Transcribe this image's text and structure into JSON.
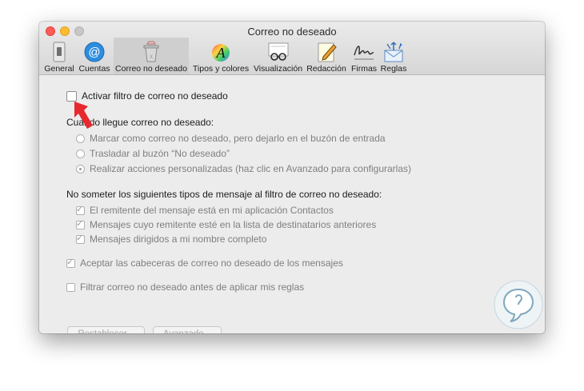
{
  "window": {
    "title": "Correo no deseado"
  },
  "toolbar": {
    "items": [
      {
        "label": "General"
      },
      {
        "label": "Cuentas"
      },
      {
        "label": "Correo no deseado"
      },
      {
        "label": "Tipos y colores"
      },
      {
        "label": "Visualización"
      },
      {
        "label": "Redacción"
      },
      {
        "label": "Firmas"
      },
      {
        "label": "Reglas"
      }
    ],
    "selected_index": 2
  },
  "settings": {
    "enable_filter": {
      "label": "Activar filtro de correo no deseado",
      "checked": false
    },
    "when_arrives": {
      "heading": "Cuando llegue correo no deseado:",
      "options": [
        {
          "label": "Marcar como correo no deseado, pero dejarlo en el buzón de entrada",
          "selected": false
        },
        {
          "label": "Trasladar al buzón “No deseado”",
          "selected": false
        },
        {
          "label": "Realizar acciones personalizadas (haz clic en Avanzado para configurarlas)",
          "selected": true
        }
      ]
    },
    "exempt": {
      "heading": "No someter los siguientes tipos de mensaje al filtro de correo no deseado:",
      "items": [
        {
          "label": "El remitente del mensaje está en mi aplicación Contactos",
          "checked": true
        },
        {
          "label": "Mensajes cuyo remitente esté en la lista de destinatarios anteriores",
          "checked": true
        },
        {
          "label": "Mensajes dirigidos a mi nombre completo",
          "checked": true
        }
      ]
    },
    "trust_headers": {
      "label": "Aceptar las cabeceras de correo no deseado de los mensajes",
      "checked": true
    },
    "filter_before_rules": {
      "label": "Filtrar correo no deseado antes de aplicar mis reglas",
      "checked": false
    }
  },
  "buttons": {
    "reset": "Restablecer...",
    "advanced": "Avanzado..."
  },
  "colors": {
    "arrow": "#e8282f",
    "logo": "#7fa8bd",
    "selected_tab": "#cfcfcf"
  }
}
